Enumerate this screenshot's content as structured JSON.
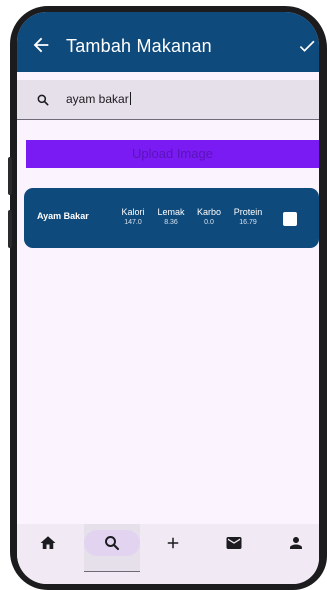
{
  "app_bar": {
    "title": "Tambah Makanan",
    "back_icon": "arrow-back-icon",
    "confirm_icon": "check-icon"
  },
  "search": {
    "icon": "search-icon",
    "value": "ayam bakar"
  },
  "upload_button": {
    "label": "Upload Image"
  },
  "food_item": {
    "name": "Ayam Bakar",
    "nutrients": [
      {
        "label": "Kalori",
        "value": "147.0"
      },
      {
        "label": "Lemak",
        "value": "8.36"
      },
      {
        "label": "Karbo",
        "value": "0.0"
      },
      {
        "label": "Protein",
        "value": "16.79"
      }
    ],
    "checked": false
  },
  "bottom_nav": {
    "items": [
      {
        "icon": "home-icon",
        "active": false
      },
      {
        "icon": "search-icon",
        "active": true
      },
      {
        "icon": "add-icon",
        "active": false
      },
      {
        "icon": "mail-icon",
        "active": false
      },
      {
        "icon": "person-icon",
        "active": false
      }
    ]
  },
  "colors": {
    "app_bar": "#0f4a7c",
    "upload_button": "#7a1bf3",
    "screen_background": "#fbf4ff",
    "nav_active_pill": "#e2d4f0"
  }
}
